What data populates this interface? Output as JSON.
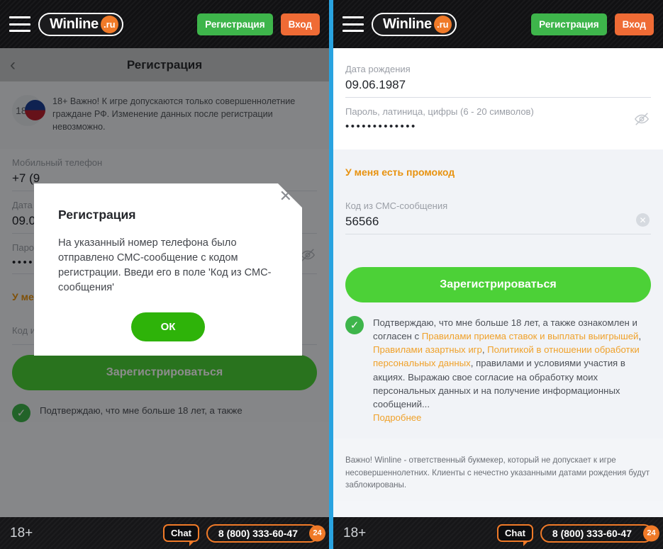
{
  "header": {
    "menu_icon": "hamburger-icon",
    "logo_name": "Winline",
    "logo_tld": ".ru",
    "register_label": "Регистрация",
    "login_label": "Вход"
  },
  "left": {
    "subheader": {
      "back_icon": "chevron-left-icon",
      "title": "Регистрация"
    },
    "notice": {
      "badge": "18+",
      "flag_icon": "russia-flag-icon",
      "text": "18+ Важно! К игре допускаются только совершеннолетние граждане РФ. Изменение данных после регистрации невозможно."
    },
    "fields": [
      {
        "label": "Мобильный телефон",
        "value": "+7 (9"
      },
      {
        "label": "Дата",
        "value": "09.0"
      },
      {
        "label": "Паро",
        "value": "•••••••"
      }
    ],
    "promo_label": "У меня есть промокод",
    "sms_label": "Код из СМС-сообщения",
    "sms_value": "",
    "submit_label": "Зарегистрироваться",
    "agree_text": "Подтверждаю, что мне больше 18 лет, а также"
  },
  "modal": {
    "close_icon": "close-icon",
    "title": "Регистрация",
    "body": "На указанный номер телефона было отправлено СМС-сообщение с кодом регистрации. Введи его в поле 'Код из СМС-сообщения'",
    "ok_label": "ОК"
  },
  "right": {
    "birth": {
      "label": "Дата рождения",
      "value": "09.06.1987"
    },
    "password": {
      "label": "Пароль, латиница, цифры (6 - 20 символов)",
      "value": "•••••••••••••",
      "toggle_icon": "eye-off-icon"
    },
    "promo_label": "У меня есть промокод",
    "sms": {
      "label": "Код из СМС-сообщения",
      "value": "56566",
      "clear_icon": "clear-circle-icon"
    },
    "submit_label": "Зарегистрироваться",
    "agree": {
      "check_icon": "check-circle-icon",
      "p1": "Подтверждаю, что мне больше 18 лет, а также ознакомлен и согласен с ",
      "link1": "Правилами приема ставок и выплаты выигрышей",
      "sep1": ", ",
      "link2": "Правилами азартных игр",
      "sep2": ", ",
      "link3": "Политикой в отношении обработки персональных данных",
      "p2": ", правилами и условиями участия в акциях. Выражаю свое согласие на обработку моих персональных данных и на получение информационных сообщений...",
      "more": "Подробнее"
    },
    "fineprint": "Важно! Winline - ответственный букмекер, который не допускает к игре несовершеннолетних. Клиенты с нечестно указанными датами рождения будут заблокированы."
  },
  "footer": {
    "age": "18+",
    "chat_label": "Chat",
    "phone": "8 (800) 333-60-47",
    "hours": "24"
  },
  "colors": {
    "green": "#4cd137",
    "green_dark": "#2eb309",
    "orange": "#f07a28",
    "link_orange": "#f0a12a",
    "divider_blue": "#29a3e0"
  }
}
